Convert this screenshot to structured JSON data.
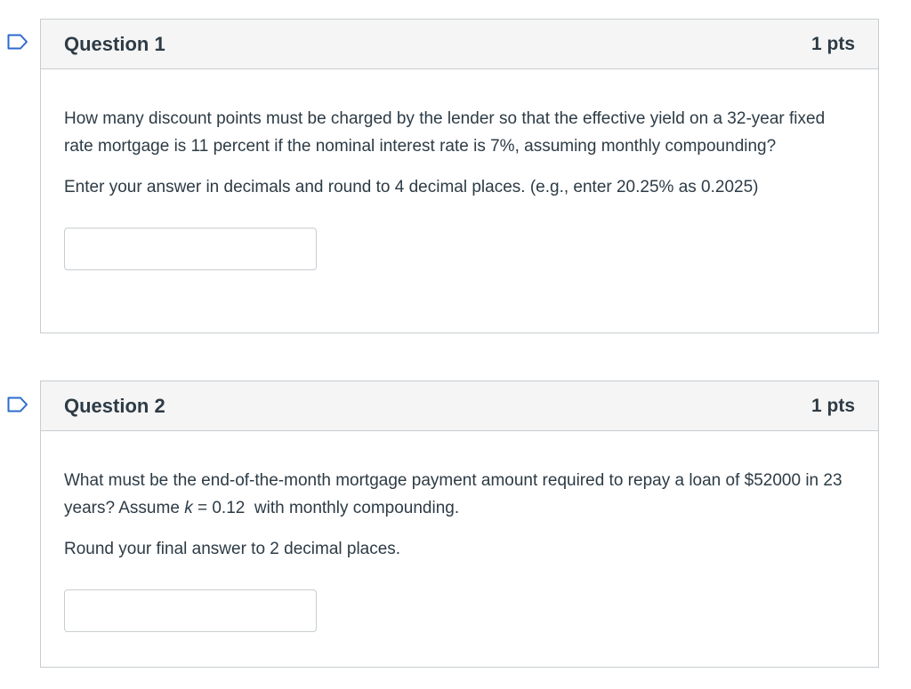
{
  "questions": [
    {
      "title": "Question 1",
      "points": "1 pts",
      "paragraphs": [
        "How many discount points must be charged by the lender so that the effective yield on a 32-year fixed rate mortgage is 11 percent if the nominal interest rate is 7%, assuming monthly compounding?",
        "Enter your answer in decimals and round to 4 decimal places. (e.g., enter 20.25% as 0.2025)"
      ],
      "answer_value": ""
    },
    {
      "title": "Question 2",
      "points": "1 pts",
      "paragraphs": [
        "What must be the end-of-the-month mortgage payment amount required to repay a loan of $52000 in 23 years? Assume",
        "k",
        "= 0.12  with monthly compounding.",
        "Round your final answer to 2 decimal places."
      ],
      "answer_value": ""
    }
  ],
  "icons": {
    "flag": "flag-question-icon"
  },
  "colors": {
    "header_bg": "#f5f5f5",
    "border": "#c7cdd1",
    "flag": "#2d6bcf",
    "text": "#2d3b45"
  }
}
